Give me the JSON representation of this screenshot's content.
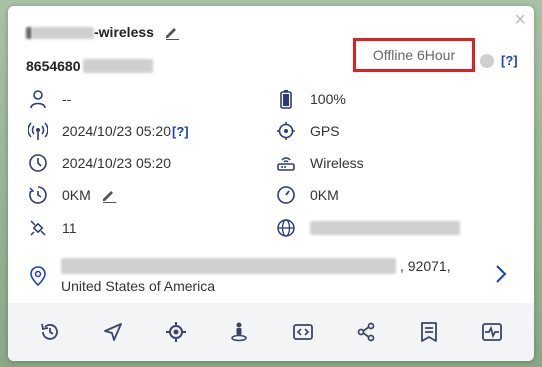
{
  "device": {
    "name_suffix": "-wireless",
    "imei_prefix": "8654680"
  },
  "status": {
    "text": "Offline 6Hour",
    "help": "[?]"
  },
  "info": {
    "driver": "--",
    "battery": "100%",
    "signal_time": "2024/10/23 05:20",
    "signal_help": "[?]",
    "location_type": "GPS",
    "gps_time": "2024/10/23 05:20",
    "connection": "Wireless",
    "mileage": "0KM",
    "odometer": "0KM",
    "satellites": "11"
  },
  "address": {
    "line1_tail": ", 92071,",
    "line2": "United States of America"
  },
  "colors": {
    "highlight_border": "#e02020",
    "link": "#1a3fbf",
    "status_dot": "#cfcfcf"
  },
  "toolbar_icons": [
    "history-icon",
    "navigate-icon",
    "locate-icon",
    "street-view-icon",
    "video-icon",
    "share-icon",
    "report-icon",
    "monitor-icon"
  ]
}
